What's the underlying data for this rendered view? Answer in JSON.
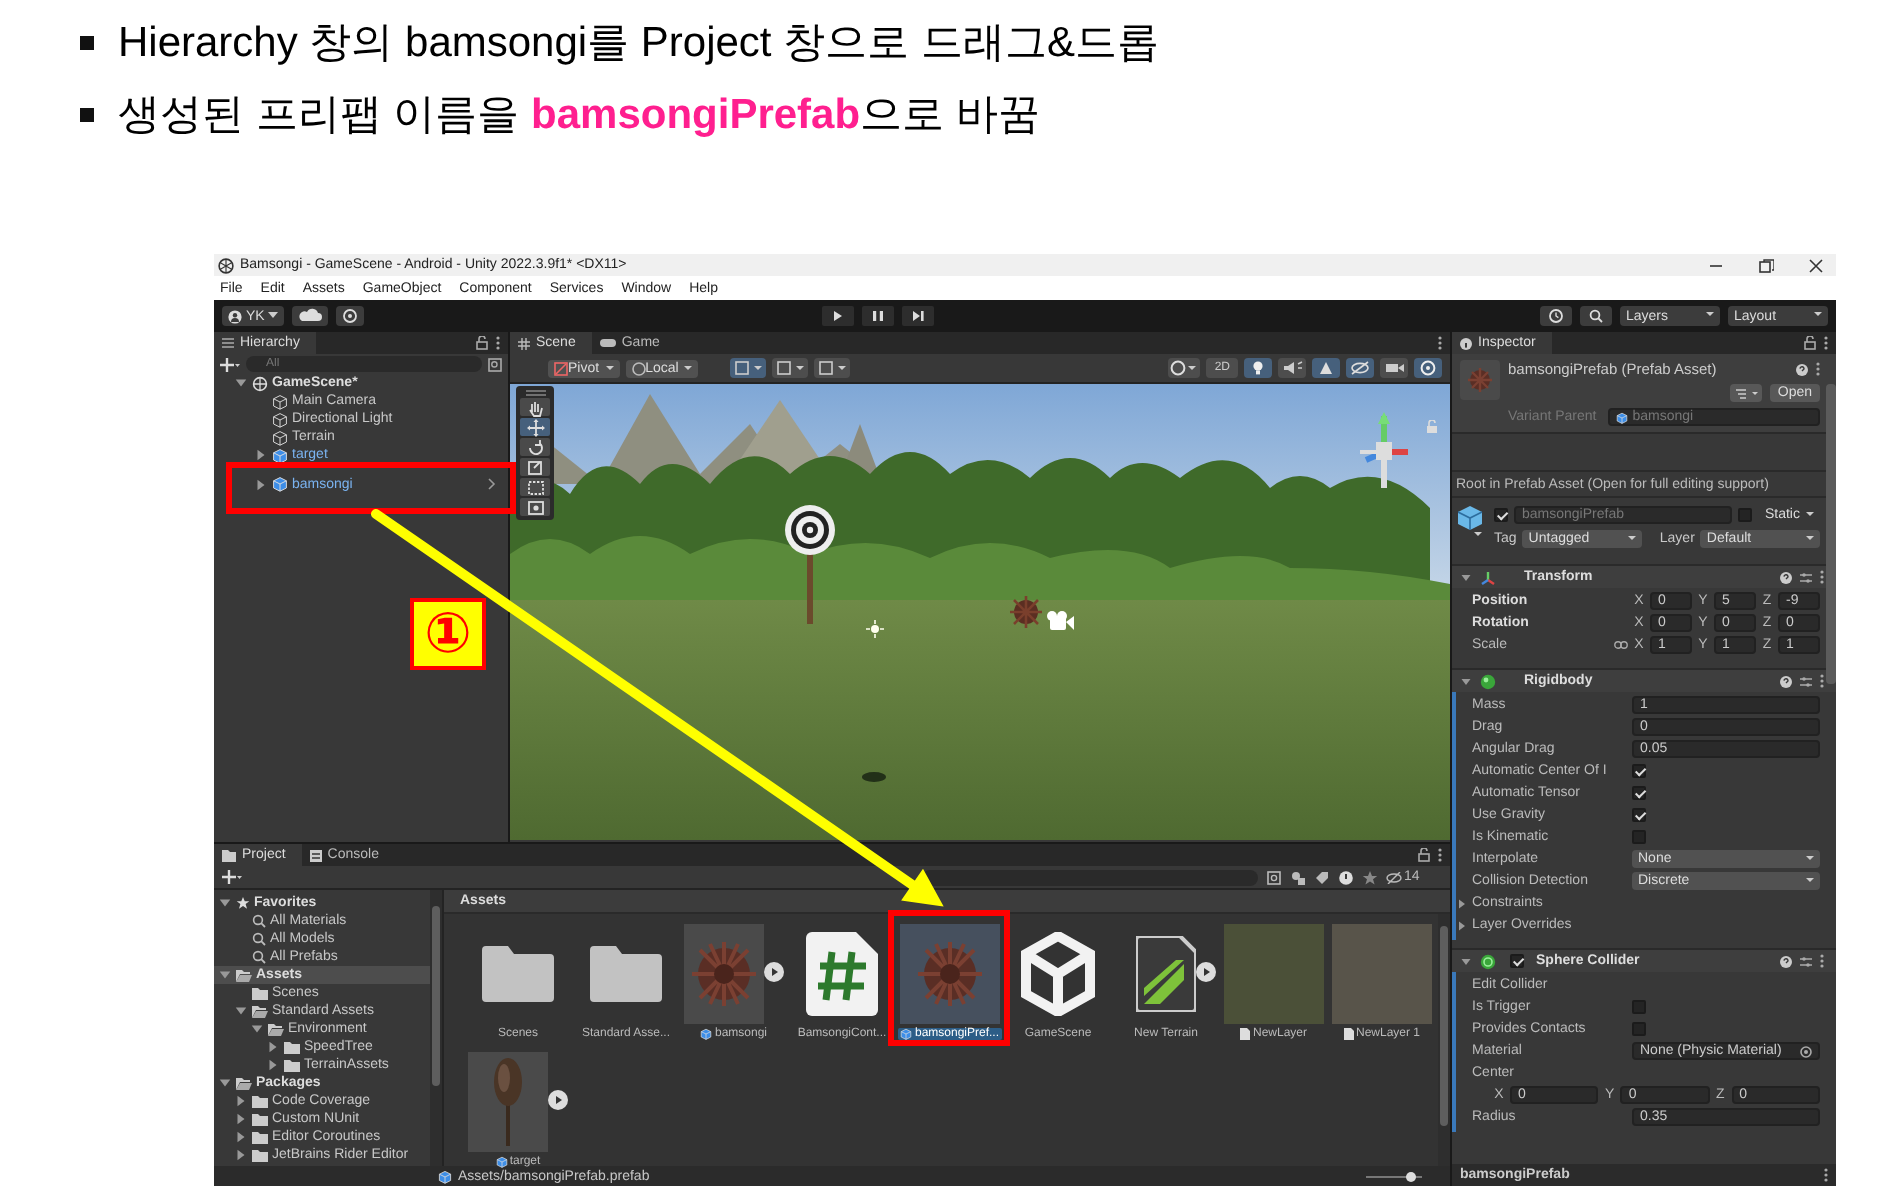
{
  "slide": {
    "bullets": [
      "Hierarchy 창의 bamsongi를 Project 창으로 드래그&드롭",
      "생성된 프리팹 이름을 **bamsongiPrefab**으로 바꿈"
    ]
  },
  "window": {
    "title": "Bamsongi - GameScene - Android - Unity 2022.3.9f1* <DX11>",
    "menu": [
      "File",
      "Edit",
      "Assets",
      "GameObject",
      "Component",
      "Services",
      "Window",
      "Help"
    ]
  },
  "toolbar": {
    "account": "YK",
    "layers": "Layers",
    "layout": "Layout"
  },
  "hierarchy": {
    "title": "Hierarchy",
    "search_placeholder": "All",
    "items": [
      {
        "label": "GameScene*",
        "kind": "scene",
        "expanded": true,
        "hovered": false,
        "children": [
          {
            "label": "Main Camera",
            "kind": "object",
            "hovered": false
          },
          {
            "label": "Directional Light",
            "kind": "object",
            "hovered": false
          },
          {
            "label": "Terrain",
            "kind": "object",
            "hovered": false
          },
          {
            "label": "target",
            "kind": "prefab",
            "expanded": false,
            "hovered": false
          },
          {
            "label": "bamsongi",
            "kind": "prefab",
            "expanded": false,
            "hovered": true
          }
        ]
      }
    ]
  },
  "scene": {
    "tabs": [
      {
        "label": "Scene",
        "kind": "scene",
        "selected": true
      },
      {
        "label": "Game",
        "kind": "game",
        "selected": false
      }
    ],
    "pivot": "Pivot",
    "space": "Local",
    "mode_2d": {
      "label": "2D",
      "on": false
    },
    "toggles": [
      {
        "kind": "lighting",
        "on": true
      },
      {
        "kind": "audio",
        "on": false
      },
      {
        "kind": "effects",
        "on": true
      },
      {
        "kind": "visibility",
        "on": true
      },
      {
        "kind": "camera",
        "on": false
      },
      {
        "kind": "gizmos",
        "on": true
      }
    ]
  },
  "inspector": {
    "title": "Inspector",
    "asset_title": "bamsongiPrefab (Prefab Asset)",
    "open_button": "Open",
    "variant_parent": {
      "label": "Variant Parent",
      "value": "bamsongi",
      "disabled": true
    },
    "note": "Root in Prefab Asset (Open for full editing support)",
    "object": {
      "active": true,
      "name": "bamsongiPrefab",
      "static_label": "Static",
      "static": false,
      "tag_label": "Tag",
      "tag": "Untagged",
      "layer_label": "Layer",
      "layer": "Default"
    },
    "components": [
      {
        "title": "Transform",
        "kind": "transform",
        "rows": [
          {
            "kind": "vector",
            "label": "Position",
            "overridden": true,
            "linked": false,
            "values": [
              {
                "axis": "X",
                "value": "0"
              },
              {
                "axis": "Y",
                "value": "5"
              },
              {
                "axis": "Z",
                "value": "-9"
              }
            ]
          },
          {
            "kind": "vector",
            "label": "Rotation",
            "overridden": true,
            "linked": false,
            "values": [
              {
                "axis": "X",
                "value": "0"
              },
              {
                "axis": "Y",
                "value": "0"
              },
              {
                "axis": "Z",
                "value": "0"
              }
            ]
          },
          {
            "kind": "vector",
            "label": "Scale",
            "overridden": false,
            "linked": true,
            "values": [
              {
                "axis": "X",
                "value": "1"
              },
              {
                "axis": "Y",
                "value": "1"
              },
              {
                "axis": "Z",
                "value": "1"
              }
            ]
          }
        ]
      },
      {
        "title": "Rigidbody",
        "kind": "rigidbody",
        "rows": [
          {
            "kind": "field",
            "label": "Mass",
            "value": "1"
          },
          {
            "kind": "field",
            "label": "Drag",
            "value": "0"
          },
          {
            "kind": "field",
            "label": "Angular Drag",
            "value": "0.05"
          },
          {
            "kind": "check",
            "label": "Automatic Center Of I",
            "checked": true
          },
          {
            "kind": "check",
            "label": "Automatic Tensor",
            "checked": true
          },
          {
            "kind": "check",
            "label": "Use Gravity",
            "checked": true
          },
          {
            "kind": "check",
            "label": "Is Kinematic",
            "checked": false
          },
          {
            "kind": "dropdown",
            "label": "Interpolate",
            "value": "None"
          },
          {
            "kind": "dropdown",
            "label": "Collision Detection",
            "value": "Discrete"
          },
          {
            "kind": "foldout",
            "label": "Constraints",
            "expanded": false
          },
          {
            "kind": "foldout",
            "label": "Layer Overrides",
            "expanded": false
          }
        ]
      },
      {
        "title": "Sphere Collider",
        "kind": "sphere-collider",
        "enabled": true,
        "rows": [
          {
            "kind": "label",
            "label": "Edit Collider"
          },
          {
            "kind": "check",
            "label": "Is Trigger",
            "checked": false
          },
          {
            "kind": "check",
            "label": "Provides Contacts",
            "checked": false
          },
          {
            "kind": "object",
            "label": "Material",
            "value": "None (Physic Material)"
          },
          {
            "kind": "label",
            "label": "Center"
          },
          {
            "kind": "vector",
            "linked": false,
            "values": [
              {
                "axis": "X",
                "value": "0"
              },
              {
                "axis": "Y",
                "value": "0"
              },
              {
                "axis": "Z",
                "value": "0"
              }
            ]
          },
          {
            "kind": "field",
            "label": "Radius",
            "value": "0.35"
          }
        ]
      }
    ],
    "footer": "bamsongiPrefab"
  },
  "project": {
    "tabs": [
      {
        "label": "Project",
        "kind": "project",
        "selected": true
      },
      {
        "label": "Console",
        "kind": "console",
        "selected": false
      }
    ],
    "hidden_count": "14",
    "tree": [
      {
        "label": "Favorites",
        "kind": "favorites",
        "expanded": true,
        "selected": false,
        "children": [
          {
            "label": "All Materials",
            "kind": "search",
            "selected": false
          },
          {
            "label": "All Models",
            "kind": "search",
            "selected": false
          },
          {
            "label": "All Prefabs",
            "kind": "search",
            "selected": false
          }
        ]
      },
      {
        "label": "Assets",
        "kind": "folder",
        "expanded": true,
        "selected": true,
        "children": [
          {
            "label": "Scenes",
            "kind": "folder",
            "selected": false
          },
          {
            "label": "Standard Assets",
            "kind": "folder",
            "expanded": true,
            "selected": false,
            "children": [
              {
                "label": "Environment",
                "kind": "folder",
                "expanded": true,
                "selected": false,
                "children": [
                  {
                    "label": "SpeedTree",
                    "kind": "folder",
                    "expanded": false,
                    "selected": false
                  },
                  {
                    "label": "TerrainAssets",
                    "kind": "folder",
                    "expanded": false,
                    "selected": false
                  }
                ]
              }
            ]
          }
        ]
      },
      {
        "label": "Packages",
        "kind": "folder",
        "expanded": true,
        "selected": false,
        "children": [
          {
            "label": "Code Coverage",
            "kind": "folder",
            "expanded": false,
            "selected": false
          },
          {
            "label": "Custom NUnit",
            "kind": "folder",
            "expanded": false,
            "selected": false
          },
          {
            "label": "Editor Coroutines",
            "kind": "folder",
            "expanded": false,
            "selected": false
          },
          {
            "label": "JetBrains Rider Editor",
            "kind": "folder",
            "expanded": false,
            "selected": false
          }
        ]
      }
    ],
    "breadcrumb": "Assets",
    "assets": [
      {
        "label": "Scenes",
        "kind": "folder",
        "selected": false
      },
      {
        "label": "Standard Asse...",
        "kind": "folder",
        "selected": false
      },
      {
        "label": "bamsongi",
        "kind": "pinecone",
        "selected": false
      },
      {
        "label": "BamsongiCont...",
        "kind": "script",
        "selected": false
      },
      {
        "label": "bamsongiPref...",
        "kind": "pinecone",
        "selected": true
      },
      {
        "label": "GameScene",
        "kind": "scene",
        "selected": false
      },
      {
        "label": "New Terrain",
        "kind": "terrain",
        "selected": false
      },
      {
        "label": "NewLayer",
        "kind": "layer",
        "color": "#4b5038",
        "selected": false
      },
      {
        "label": "NewLayer 1",
        "kind": "layer",
        "color": "#58544a",
        "selected": false
      },
      {
        "label": "target",
        "kind": "target",
        "selected": false
      }
    ],
    "path": "Assets/bamsongiPrefab.prefab",
    "zoom": {
      "level": 0.8
    }
  },
  "annotation": {
    "step": "①"
  }
}
